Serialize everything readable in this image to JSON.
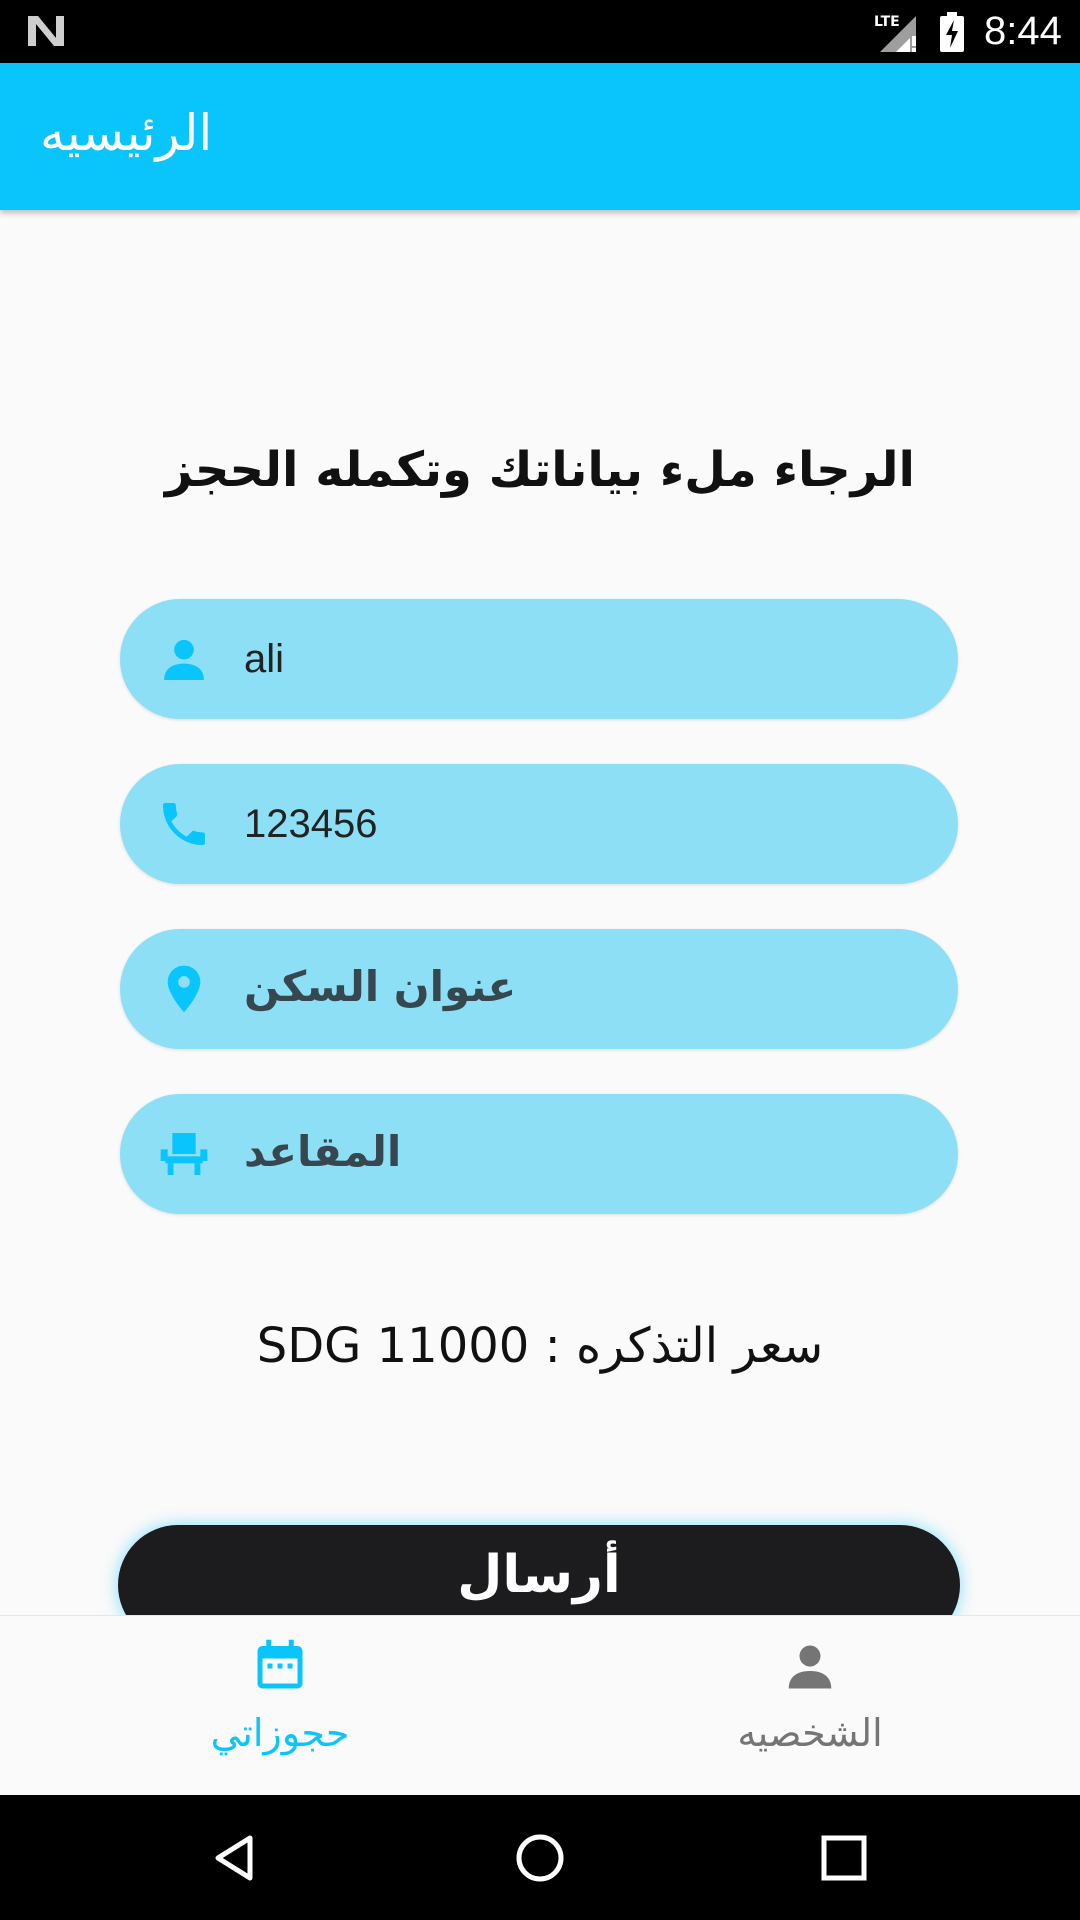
{
  "status_bar": {
    "time": "8:44",
    "network": "LTE"
  },
  "app_bar": {
    "title": "الرئيسيه"
  },
  "form": {
    "heading": "الرجاء ملء بياناتك وتكمله الحجز",
    "name": {
      "value": "ali",
      "icon": "person-icon"
    },
    "phone": {
      "value": "123456",
      "icon": "phone-icon"
    },
    "address": {
      "placeholder": "عنوان السكن",
      "icon": "location-pin-icon"
    },
    "seats": {
      "placeholder": "المقاعد",
      "icon": "seat-icon"
    },
    "price_text": "SDG 11000 :  سعر التذكره",
    "submit_label": "أرسال"
  },
  "bottom_nav": {
    "items": [
      {
        "label": "حجوزاتي",
        "icon": "calendar-icon",
        "active": true
      },
      {
        "label": "الشخصيه",
        "icon": "person-icon",
        "active": false
      }
    ]
  },
  "colors": {
    "accent": "#0ac5fb",
    "field_bg": "#8ddff5",
    "button_bg": "#1c1c1e",
    "inactive": "#757575"
  }
}
